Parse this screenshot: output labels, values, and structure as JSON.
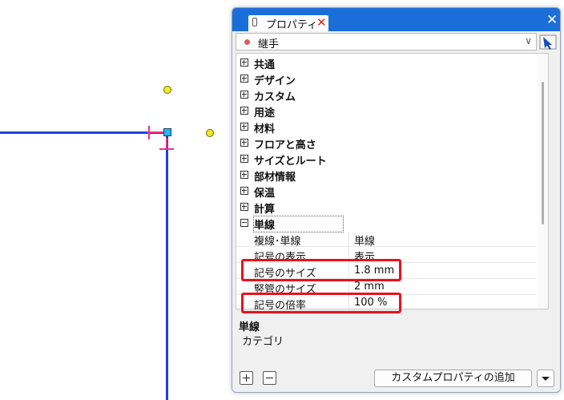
{
  "panel": {
    "tab_title": "プロパティ",
    "tab_close": "✕",
    "close": "✕"
  },
  "selector": {
    "value": "継手",
    "chevron": "∨"
  },
  "categories": [
    {
      "label": "共通",
      "expanded": false
    },
    {
      "label": "デザイン",
      "expanded": false
    },
    {
      "label": "カスタム",
      "expanded": false
    },
    {
      "label": "用途",
      "expanded": false
    },
    {
      "label": "材料",
      "expanded": false
    },
    {
      "label": "フロアと高さ",
      "expanded": false
    },
    {
      "label": "サイズとルート",
      "expanded": false
    },
    {
      "label": "部材情報",
      "expanded": false
    },
    {
      "label": "保温",
      "expanded": false
    },
    {
      "label": "計算",
      "expanded": false
    },
    {
      "label": "単線",
      "expanded": true
    }
  ],
  "properties": [
    {
      "name": "複線･単線",
      "value": "単線",
      "highlighted": false
    },
    {
      "name": "記号の表示",
      "value": "表示",
      "highlighted": false
    },
    {
      "name": "記号のサイズ",
      "value": "1.8 mm",
      "highlighted": true
    },
    {
      "name": "竪管のサイズ",
      "value": "2 mm",
      "highlighted": false
    },
    {
      "name": "記号の倍率",
      "value": "100 %",
      "highlighted": true
    }
  ],
  "description": {
    "title": "単線",
    "text": "カテゴリ"
  },
  "footer": {
    "add_custom": "カスタムプロパティの追加"
  },
  "colors": {
    "pipe": "#1f3fe0",
    "tick": "#e8308c",
    "grip_circle": "#f2ea22",
    "grip_square": "#27b4e8",
    "titlebar": "#1b6ed8",
    "highlight": "#e8121e"
  }
}
